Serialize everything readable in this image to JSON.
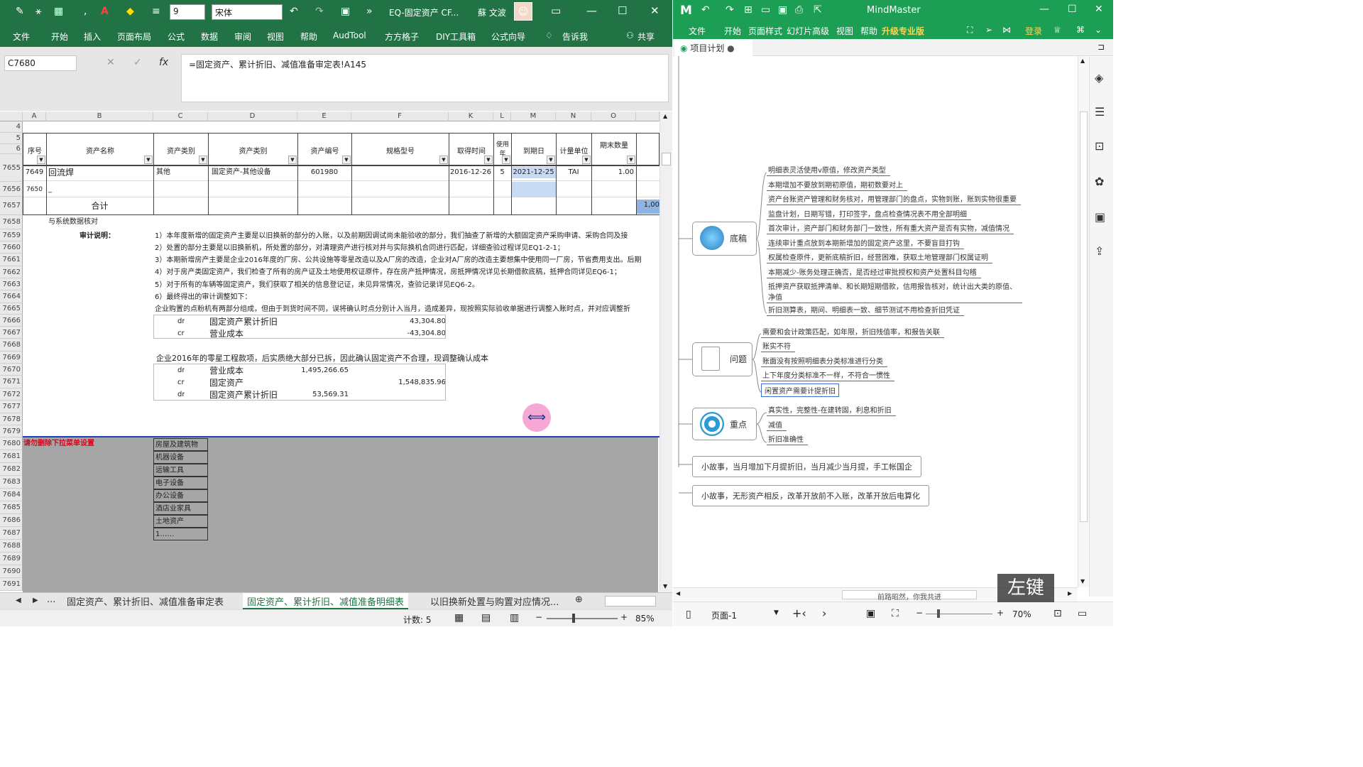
{
  "excel": {
    "title": "EQ-固定资产 CF...",
    "user": "蘇 文波",
    "font_size": "9",
    "font_name": "宋体",
    "menu": [
      "文件",
      "开始",
      "插入",
      "页面布局",
      "公式",
      "数据",
      "审阅",
      "视图",
      "帮助",
      "AudTool",
      "方方格子",
      "DIY工具箱",
      "公式向导",
      "告诉我",
      "共享"
    ],
    "name_box": "C7680",
    "formula": "=固定资产、累计折旧、减值准备审定表!A145",
    "columns": [
      "A",
      "B",
      "C",
      "D",
      "E",
      "F",
      "K",
      "L",
      "M",
      "N",
      "O"
    ],
    "header_row": [
      "序号",
      "资产名称",
      "资产类别",
      "资产类别",
      "资产编号",
      "规格型号",
      "取得时间",
      "使用年",
      "到期日",
      "计量单位",
      "期末数量"
    ],
    "row_nums": [
      "4",
      "5",
      "6",
      "7655",
      "7656",
      "7657",
      "7658",
      "7659",
      "7660",
      "7661",
      "7662",
      "7663",
      "7664",
      "7665",
      "7666",
      "7667",
      "7668",
      "7669",
      "7670",
      "7671",
      "7672",
      "7677",
      "7678",
      "7679",
      "7680",
      "7681",
      "7682",
      "7683",
      "7684",
      "7685",
      "7686",
      "7687",
      "7688",
      "7689",
      "7690",
      "7691"
    ],
    "data_row": {
      "seq": "7649",
      "name": "回流焊",
      "cat1": "其他",
      "cat2": "固定资产-其他设备",
      "code": "601980",
      "date": "2016-12-26",
      "years": "5",
      "due": "2021-12-25",
      "unit": "TAI",
      "qty": "1.00"
    },
    "row7656_seq": "7650",
    "row7656_name": "_",
    "total_label": "合计",
    "total_value": "1,00",
    "check_label": "与系统数据核对",
    "audit_label": "审计说明：",
    "audit_notes": [
      "1）本年度新增的固定资产主要是以旧换新的部分的入账，以及前期因调试尚未能验收的部分，我们抽查了新增的大额固定资产采购申请、采购合同及接",
      "2）处置的部分主要是以旧换新机，所处置的部分，对清理资产进行核对并与实际换机合同进行匹配，详细查验过程详见EQ1-2-1；",
      "3）本期新增房产主要是企业2016年度的厂房、公共设施等零星改造以及A厂房的改造，企业对A厂房的改造主要想集中使用同一厂房，节省费用支出。后期",
      "4）对于房产类固定资产，我们检查了所有的房产证及土地使用权证原件，存在房产抵押情况，房抵押情况详见长期借款底稿，抵押合同详见EQ6-1；",
      "5）对于所有的车辆等固定资产，我们获取了相关的信息登记证，未见异常情况，查验记录详见EQ6-2。",
      "6）最终得出的审计调整如下：",
      "企业购置的点粉机有两部分组成，但由于到货时间不同，误将确认时点分别计入当月，造成差异，现按照实际验收单据进行调整入账时点，并对应调整折"
    ],
    "adj1": [
      {
        "dc": "dr",
        "acct": "固定资产累计折旧",
        "amt": "43,304.80"
      },
      {
        "dc": "cr",
        "acct": "营业成本",
        "amt": "-43,304.80"
      }
    ],
    "note2": "企业2016年的零星工程款项，后实质绝大部分已拆，因此确认固定资产不合理，现调整确认成本",
    "adj2": [
      {
        "dc": "dr",
        "acct": "营业成本",
        "amt_e": "1,495,266.65",
        "amt_f": ""
      },
      {
        "dc": "cr",
        "acct": "固定资产",
        "amt_e": "",
        "amt_f": "1,548,835.96"
      },
      {
        "dc": "dr",
        "acct": "固定资产累计折旧",
        "amt_e": "53,569.31",
        "amt_f": ""
      }
    ],
    "warning": "请勿删除下拉菜单设置",
    "dropdown_items": [
      "房屋及建筑物",
      "机器设备",
      "运输工具",
      "电子设备",
      "办公设备",
      "酒店业家具",
      "土地资产",
      "1……"
    ],
    "sheet_tabs": [
      "固定资产、累计折旧、减值准备审定表",
      "固定资产、累计折旧、减值准备明细表",
      "以旧换新处置与购置对应情况..."
    ],
    "tab_nav": [
      "◀",
      "▶",
      "..."
    ],
    "status_count": "计数: 5",
    "zoom": "85%",
    "colors": {
      "ribbon": "#217346",
      "accent_red": "#e0001a"
    }
  },
  "mindmaster": {
    "title": "MindMaster",
    "menu": [
      "文件",
      "开始",
      "页面样式",
      "幻灯片",
      "高级",
      "视图",
      "帮助"
    ],
    "upgrade": "升级专业版",
    "login": "登录",
    "doc_tab": "项目计划",
    "nodes": {
      "base": {
        "label": "底稿",
        "leaves": [
          "明细表灵活使用v原值，修改资产类型",
          "本期增加不要放到期初原值，期初数要对上",
          "资产台账资产管理和财务核对，用管理部门的盘点，实物到账，账到实物很重要",
          "监盘计划，日期写错，打印签字，盘点检查情况表不用全部明细",
          "首次审计，资产部门和财务部门一致性，所有重大资产是否有实物，减值情况",
          "连续审计重点放到本期新增加的固定资产这里，不要盲目打钩",
          "权属检查原件，更新底稿折旧，经营困难，获取土地管理部门权属证明",
          "本期减少-账务处理正确否，是否经过审批授权和资产处置科目勾稽",
          "抵押资产获取抵押清单、和长期短期借款，信用报告核对，统计出大类的原值、净值",
          "折旧测算表，期间、明细表一致、细节测试不用检查折旧凭证"
        ]
      },
      "issue": {
        "label": "问题",
        "leaves": [
          "需要和会计政策匹配，如年限，折旧残值率，和报告关联",
          "账实不符",
          "账面没有按照明细表分类标准进行分类",
          "上下年度分类标准不一样，不符合一惯性",
          "闲置资产需要计提折旧"
        ]
      },
      "key": {
        "label": "重点",
        "leaves": [
          "真实性，完整性-在建转固，利息和折旧",
          "减值",
          "折旧准确性"
        ]
      }
    },
    "stories": [
      "小故事，当月增加下月提折旧，当月减少当月提，手工帐国企",
      "小故事，无形资产相反，改革开放前不入账，改革开放后电算化"
    ],
    "hscroll_text": "前路昭然，你我共进",
    "page": "页面-1",
    "zoom": "70%",
    "watermark": "左键"
  }
}
